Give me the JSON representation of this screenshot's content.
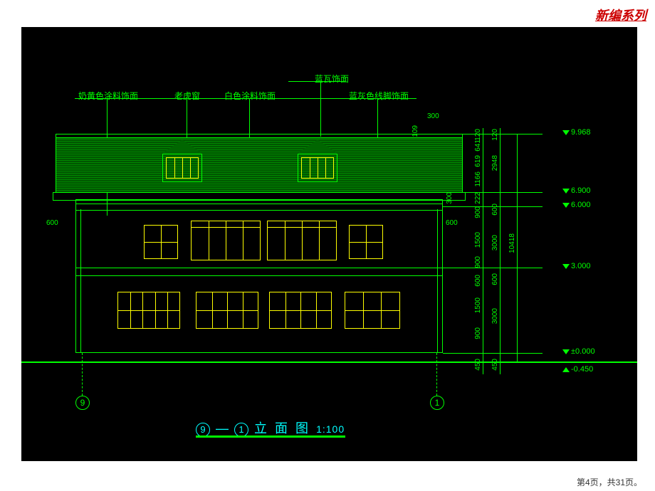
{
  "header": {
    "series_label": "新编系列"
  },
  "footer": {
    "page_info": "第4页，共31页。"
  },
  "labels": {
    "l1": "奶黄色涂料饰面",
    "l2": "老虎窗",
    "l3": "白色涂料饰面",
    "l4": "蓝瓦饰面",
    "l5": "蓝灰色线脚饰面"
  },
  "title": {
    "text": "立 面 图",
    "scale": "1:100",
    "axis_left": "⑨",
    "axis_right": "①",
    "dash": "—"
  },
  "axes": {
    "left": "9",
    "right": "1"
  },
  "dims_top": {
    "d300": "300",
    "d109": "109"
  },
  "dims_side_left": {
    "d600": "600"
  },
  "dims_side_right": {
    "d600": "600",
    "d300": "300"
  },
  "dims_col1": {
    "v120a": "120",
    "v641": "641",
    "v619": "619",
    "v1166": "1166",
    "v222": "222",
    "v900a": "900",
    "v1500a": "1500",
    "v900b": "900",
    "v600a": "600",
    "v1500b": "1500",
    "v900c": "900",
    "v450": "450"
  },
  "dims_col2": {
    "v120": "120",
    "v2948": "2948",
    "v600a": "600",
    "v3000a": "3000",
    "v600b": "600",
    "v3000b": "3000",
    "v450": "450"
  },
  "dims_col3": {
    "v10418": "10418"
  },
  "elevations": {
    "e1": "9.968",
    "e2": "6.900",
    "e3": "6.000",
    "e4": "3.000",
    "e5": "±0.000",
    "e6": "-0.450"
  }
}
